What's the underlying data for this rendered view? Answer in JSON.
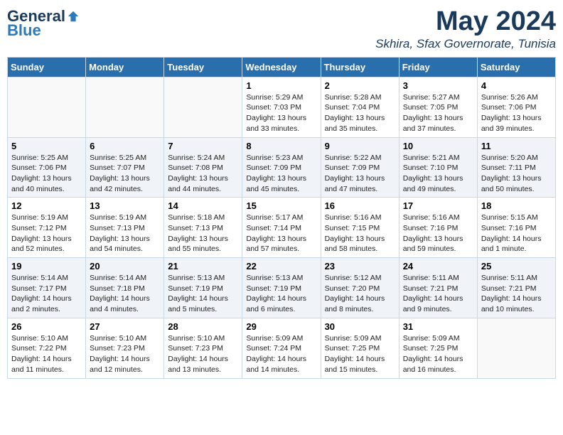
{
  "logo": {
    "general": "General",
    "blue": "Blue"
  },
  "header": {
    "month_year": "May 2024",
    "location": "Skhira, Sfax Governorate, Tunisia"
  },
  "days_of_week": [
    "Sunday",
    "Monday",
    "Tuesday",
    "Wednesday",
    "Thursday",
    "Friday",
    "Saturday"
  ],
  "weeks": [
    [
      {
        "day": "",
        "info": ""
      },
      {
        "day": "",
        "info": ""
      },
      {
        "day": "",
        "info": ""
      },
      {
        "day": "1",
        "info": "Sunrise: 5:29 AM\nSunset: 7:03 PM\nDaylight: 13 hours\nand 33 minutes."
      },
      {
        "day": "2",
        "info": "Sunrise: 5:28 AM\nSunset: 7:04 PM\nDaylight: 13 hours\nand 35 minutes."
      },
      {
        "day": "3",
        "info": "Sunrise: 5:27 AM\nSunset: 7:05 PM\nDaylight: 13 hours\nand 37 minutes."
      },
      {
        "day": "4",
        "info": "Sunrise: 5:26 AM\nSunset: 7:06 PM\nDaylight: 13 hours\nand 39 minutes."
      }
    ],
    [
      {
        "day": "5",
        "info": "Sunrise: 5:25 AM\nSunset: 7:06 PM\nDaylight: 13 hours\nand 40 minutes."
      },
      {
        "day": "6",
        "info": "Sunrise: 5:25 AM\nSunset: 7:07 PM\nDaylight: 13 hours\nand 42 minutes."
      },
      {
        "day": "7",
        "info": "Sunrise: 5:24 AM\nSunset: 7:08 PM\nDaylight: 13 hours\nand 44 minutes."
      },
      {
        "day": "8",
        "info": "Sunrise: 5:23 AM\nSunset: 7:09 PM\nDaylight: 13 hours\nand 45 minutes."
      },
      {
        "day": "9",
        "info": "Sunrise: 5:22 AM\nSunset: 7:09 PM\nDaylight: 13 hours\nand 47 minutes."
      },
      {
        "day": "10",
        "info": "Sunrise: 5:21 AM\nSunset: 7:10 PM\nDaylight: 13 hours\nand 49 minutes."
      },
      {
        "day": "11",
        "info": "Sunrise: 5:20 AM\nSunset: 7:11 PM\nDaylight: 13 hours\nand 50 minutes."
      }
    ],
    [
      {
        "day": "12",
        "info": "Sunrise: 5:19 AM\nSunset: 7:12 PM\nDaylight: 13 hours\nand 52 minutes."
      },
      {
        "day": "13",
        "info": "Sunrise: 5:19 AM\nSunset: 7:13 PM\nDaylight: 13 hours\nand 54 minutes."
      },
      {
        "day": "14",
        "info": "Sunrise: 5:18 AM\nSunset: 7:13 PM\nDaylight: 13 hours\nand 55 minutes."
      },
      {
        "day": "15",
        "info": "Sunrise: 5:17 AM\nSunset: 7:14 PM\nDaylight: 13 hours\nand 57 minutes."
      },
      {
        "day": "16",
        "info": "Sunrise: 5:16 AM\nSunset: 7:15 PM\nDaylight: 13 hours\nand 58 minutes."
      },
      {
        "day": "17",
        "info": "Sunrise: 5:16 AM\nSunset: 7:16 PM\nDaylight: 13 hours\nand 59 minutes."
      },
      {
        "day": "18",
        "info": "Sunrise: 5:15 AM\nSunset: 7:16 PM\nDaylight: 14 hours\nand 1 minute."
      }
    ],
    [
      {
        "day": "19",
        "info": "Sunrise: 5:14 AM\nSunset: 7:17 PM\nDaylight: 14 hours\nand 2 minutes."
      },
      {
        "day": "20",
        "info": "Sunrise: 5:14 AM\nSunset: 7:18 PM\nDaylight: 14 hours\nand 4 minutes."
      },
      {
        "day": "21",
        "info": "Sunrise: 5:13 AM\nSunset: 7:19 PM\nDaylight: 14 hours\nand 5 minutes."
      },
      {
        "day": "22",
        "info": "Sunrise: 5:13 AM\nSunset: 7:19 PM\nDaylight: 14 hours\nand 6 minutes."
      },
      {
        "day": "23",
        "info": "Sunrise: 5:12 AM\nSunset: 7:20 PM\nDaylight: 14 hours\nand 8 minutes."
      },
      {
        "day": "24",
        "info": "Sunrise: 5:11 AM\nSunset: 7:21 PM\nDaylight: 14 hours\nand 9 minutes."
      },
      {
        "day": "25",
        "info": "Sunrise: 5:11 AM\nSunset: 7:21 PM\nDaylight: 14 hours\nand 10 minutes."
      }
    ],
    [
      {
        "day": "26",
        "info": "Sunrise: 5:10 AM\nSunset: 7:22 PM\nDaylight: 14 hours\nand 11 minutes."
      },
      {
        "day": "27",
        "info": "Sunrise: 5:10 AM\nSunset: 7:23 PM\nDaylight: 14 hours\nand 12 minutes."
      },
      {
        "day": "28",
        "info": "Sunrise: 5:10 AM\nSunset: 7:23 PM\nDaylight: 14 hours\nand 13 minutes."
      },
      {
        "day": "29",
        "info": "Sunrise: 5:09 AM\nSunset: 7:24 PM\nDaylight: 14 hours\nand 14 minutes."
      },
      {
        "day": "30",
        "info": "Sunrise: 5:09 AM\nSunset: 7:25 PM\nDaylight: 14 hours\nand 15 minutes."
      },
      {
        "day": "31",
        "info": "Sunrise: 5:09 AM\nSunset: 7:25 PM\nDaylight: 14 hours\nand 16 minutes."
      },
      {
        "day": "",
        "info": ""
      }
    ]
  ]
}
